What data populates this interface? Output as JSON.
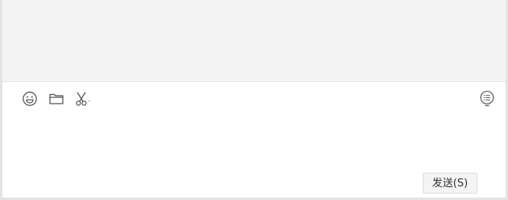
{
  "toolbar": {
    "left_icons": [
      "emoji-icon",
      "folder-icon",
      "scissors-icon"
    ],
    "right_icons": [
      "chat-history-icon"
    ]
  },
  "send_button": {
    "label": "发送(S)"
  },
  "colors": {
    "message_area_bg": "#f4f4f4",
    "input_bg": "#ffffff",
    "icon_stroke": "#555555",
    "button_bg": "#f4f4f4",
    "button_border": "#dcdcdc"
  }
}
